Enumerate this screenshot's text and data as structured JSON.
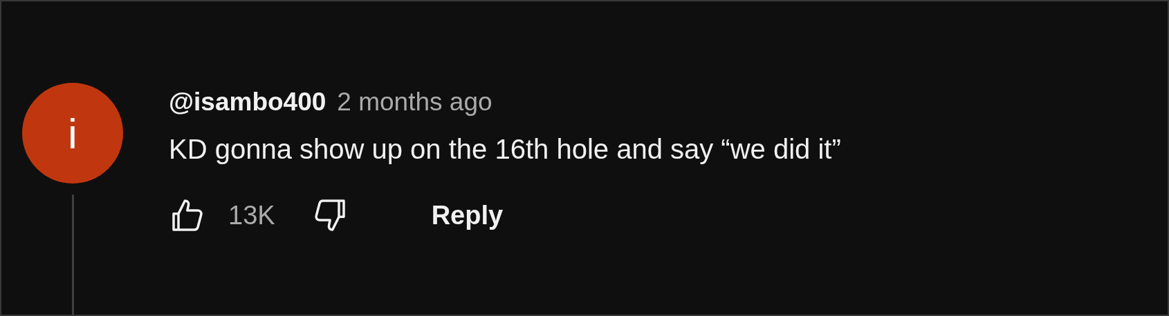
{
  "comment": {
    "avatar_letter": "i",
    "author": "@isambo400",
    "time": "2 months ago",
    "text": "KD gonna show up on the 16th hole and say “we did it”",
    "likes": "13K",
    "reply_label": "Reply"
  }
}
